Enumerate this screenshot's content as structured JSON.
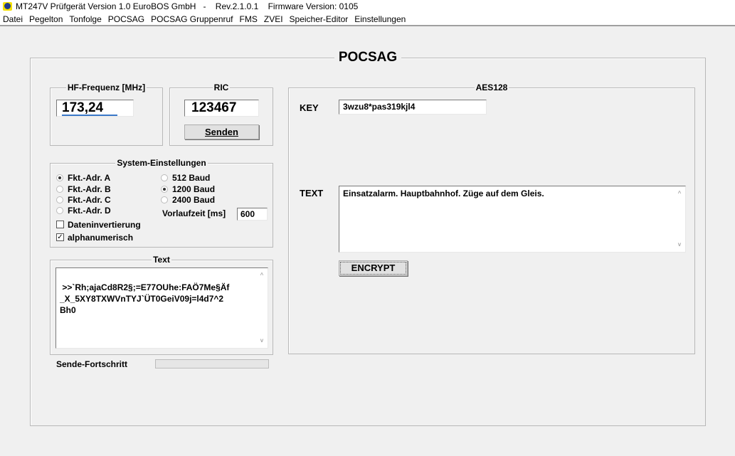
{
  "window": {
    "title": "MT247V Prüfgerät Version 1.0 EuroBOS GmbH   -    Rev.2.1.0.1    Firmware Version: 0105"
  },
  "menu": [
    "Datei",
    "Pegelton",
    "Tonfolge",
    "POCSAG",
    "POCSAG Gruppenruf",
    "FMS",
    "ZVEI",
    "Speicher-Editor",
    "Einstellungen"
  ],
  "panel": {
    "title": "POCSAG"
  },
  "hf": {
    "label": "HF-Frequenz [MHz]",
    "value": "173,24"
  },
  "ric": {
    "label": "RIC",
    "value": "123467",
    "send_label": "Senden"
  },
  "system": {
    "label": "System-Einstellungen",
    "addresses": [
      {
        "label": "Fkt.-Adr. A",
        "checked": true
      },
      {
        "label": "Fkt.-Adr. B",
        "checked": false
      },
      {
        "label": "Fkt.-Adr. C",
        "checked": false
      },
      {
        "label": "Fkt.-Adr. D",
        "checked": false
      }
    ],
    "bauds": [
      {
        "label": "512 Baud",
        "checked": false
      },
      {
        "label": "1200 Baud",
        "checked": true
      },
      {
        "label": "2400 Baud",
        "checked": false
      }
    ],
    "preamble_label": "Vorlaufzeit [ms]",
    "preamble_value": "600",
    "inversion": {
      "label": "Dateninvertierung",
      "checked": false
    },
    "alpha": {
      "label": "alphanumerisch",
      "checked": true
    }
  },
  "text": {
    "label": "Text",
    "value": ">>`Rh;ajaCd8R2§;=E77OUhe:FAÖ7Me§Äf\n_X_5XY8TXWVnTYJ`ÜT0GeiV09j=l4d7^2\nBh0"
  },
  "progress": {
    "label": "Sende-Fortschritt",
    "value": 0
  },
  "aes": {
    "label": "AES128",
    "key_label": "KEY",
    "key_value": "3wzu8*pas319kjl4",
    "text_label": "TEXT",
    "text_value": "Einsatzalarm. Hauptbahnhof. Züge auf dem Gleis.",
    "encrypt_label": "ENCRYPT"
  },
  "icons": {
    "scroll_up": "^",
    "scroll_down": "v",
    "check": "✓"
  }
}
